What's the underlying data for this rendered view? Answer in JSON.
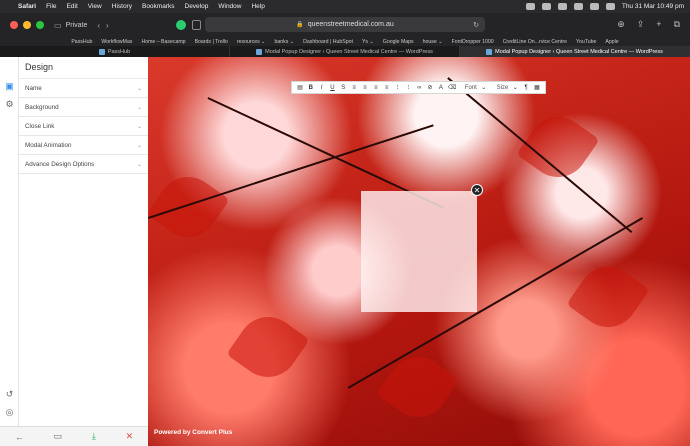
{
  "menubar": {
    "app": "Safari",
    "items": [
      "File",
      "Edit",
      "View",
      "History",
      "Bookmarks",
      "Develop",
      "Window",
      "Help"
    ],
    "clock": "Thu 31 Mar  10:49 pm"
  },
  "browser": {
    "private_label": "Private",
    "url": "queenstreetmedical.com.au",
    "favorites": [
      "PassHub",
      "WorkflowMax",
      "Home – Basecamp",
      "Boards | Trello",
      "resources ⌄",
      "banks ⌄",
      "Dashboard | HubSpot",
      "Ys ⌄",
      "Google Maps",
      "house ⌄",
      "FontDropper 1000",
      "CreditLine On...rvice Centre",
      "YouTube",
      "Apple"
    ],
    "tabs": [
      {
        "label": "PassHub",
        "active": false
      },
      {
        "label": "Modal Popup Designer ‹ Queen Street Medical Centre — WordPress",
        "active": false
      },
      {
        "label": "Modal Popup Designer ‹ Queen Street Medical Centre — WordPress",
        "active": true
      }
    ]
  },
  "panel": {
    "title": "Design",
    "sections": [
      "Name",
      "Background",
      "Close Link",
      "Modal Animation",
      "Advance Design Options"
    ]
  },
  "editor_toolbar": {
    "font_label": "Font",
    "size_label": "Size"
  },
  "canvas": {
    "powered_by": "Powered by Convert Plus"
  },
  "colors": {
    "accent_green": "#2ecc71",
    "download_green": "#27ae60",
    "close_red": "#e74c3c"
  }
}
